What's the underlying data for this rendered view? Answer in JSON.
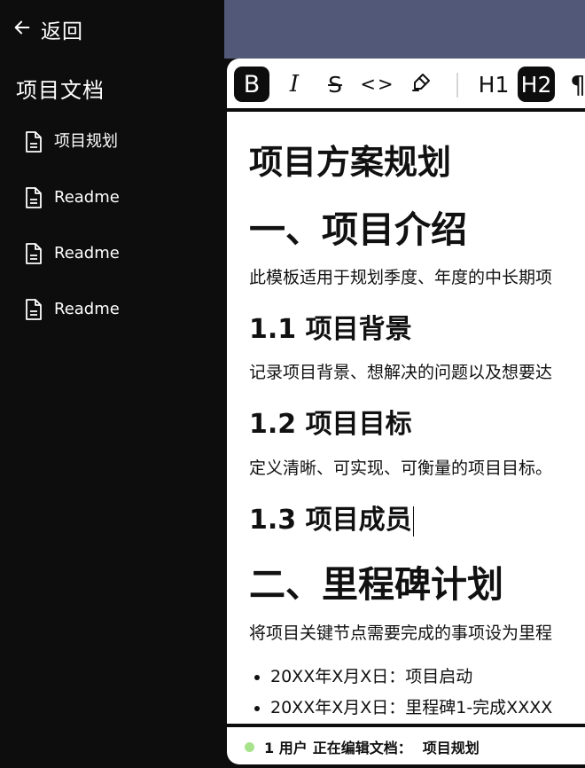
{
  "sidebar": {
    "back_label": "返回",
    "section_title": "项目文档",
    "items": [
      {
        "label": "项目规划"
      },
      {
        "label": "Readme"
      },
      {
        "label": "Readme"
      },
      {
        "label": "Readme"
      }
    ]
  },
  "colors": {
    "sidebar_bg": "#0d0d0d",
    "top_band": "#515878",
    "online_dot": "#a6e38b"
  },
  "toolbar": {
    "bold": "B",
    "italic": "I",
    "strike": "S",
    "code": "<>",
    "highlight": "highlighter-icon",
    "h1": "H1",
    "h2": "H2",
    "paragraph": "¶",
    "active": [
      "bold",
      "h2"
    ]
  },
  "doc": {
    "title": "项目方案规划",
    "s1_heading": "一、项目介绍",
    "s1_text": "此模板适用于规划季度、年度的中长期项",
    "s11_heading": "1.1 项目背景",
    "s11_text": "记录项目背景、想解决的问题以及想要达",
    "s12_heading": "1.2 项目目标",
    "s12_text": "定义清晰、可实现、可衡量的项目目标。",
    "s13_heading": "1.3 项目成员",
    "s2_heading": "二、里程碑计划",
    "s2_text": "将项目关键节点需要完成的事项设为里程",
    "bullets": [
      "20XX年X月X日：项目启动",
      "20XX年X月X日：里程碑1-完成XXXX"
    ]
  },
  "status": {
    "users": "1 用户",
    "editing_label": "正在编辑文档：",
    "doc_name": "项目规划"
  }
}
